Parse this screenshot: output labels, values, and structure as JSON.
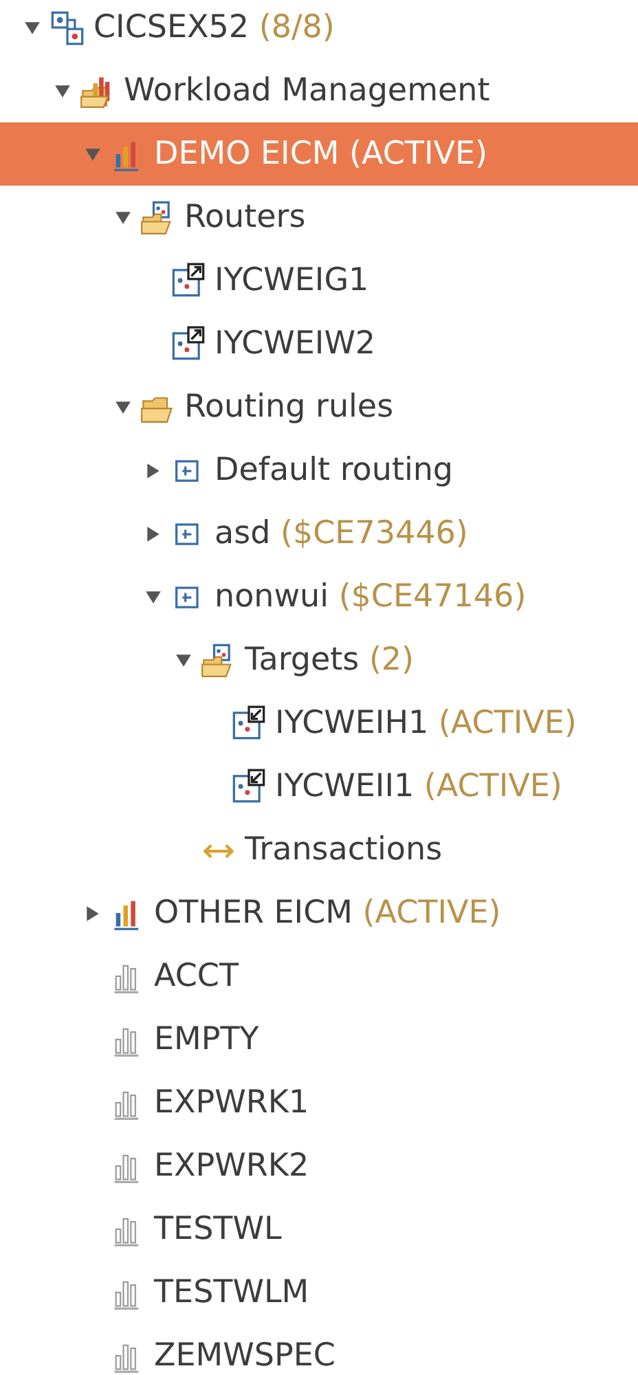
{
  "tree": [
    {
      "kind": "system",
      "label": "CICSEX52",
      "suffix": "(8/8)",
      "expanded": true,
      "selected": false,
      "children": [
        {
          "kind": "workload-folder",
          "label": "Workload Management",
          "expanded": true,
          "selected": false,
          "children": [
            {
              "kind": "workload-active",
              "label": "DEMO EICM (ACTIVE)",
              "expanded": true,
              "selected": true,
              "children": [
                {
                  "kind": "router-folder",
                  "label": "Routers",
                  "expanded": true,
                  "selected": false,
                  "children": [
                    {
                      "kind": "router",
                      "label": "IYCWEIG1",
                      "selected": false
                    },
                    {
                      "kind": "router",
                      "label": "IYCWEIW2",
                      "selected": false
                    }
                  ]
                },
                {
                  "kind": "folder",
                  "label": "Routing rules",
                  "expanded": true,
                  "selected": false,
                  "children": [
                    {
                      "kind": "rule",
                      "label": "Default routing",
                      "expanded": false,
                      "selected": false
                    },
                    {
                      "kind": "rule",
                      "label": "asd",
                      "suffix": "($CE73446)",
                      "expanded": false,
                      "selected": false
                    },
                    {
                      "kind": "rule",
                      "label": "nonwui",
                      "suffix": "($CE47146)",
                      "expanded": true,
                      "selected": false,
                      "children": [
                        {
                          "kind": "router-folder",
                          "label": "Targets",
                          "suffix": "(2)",
                          "expanded": true,
                          "selected": false,
                          "children": [
                            {
                              "kind": "target",
                              "label": "IYCWEIH1",
                              "suffix": "(ACTIVE)",
                              "selected": false
                            },
                            {
                              "kind": "target",
                              "label": "IYCWEII1",
                              "suffix": "(ACTIVE)",
                              "selected": false
                            }
                          ]
                        },
                        {
                          "kind": "transactions",
                          "label": "Transactions",
                          "selected": false
                        }
                      ]
                    }
                  ]
                }
              ]
            },
            {
              "kind": "workload-active",
              "label": "OTHER EICM",
              "suffix": "(ACTIVE)",
              "expanded": false,
              "selected": false
            },
            {
              "kind": "workload",
              "label": "ACCT",
              "selected": false
            },
            {
              "kind": "workload",
              "label": "EMPTY",
              "selected": false
            },
            {
              "kind": "workload",
              "label": "EXPWRK1",
              "selected": false
            },
            {
              "kind": "workload",
              "label": "EXPWRK2",
              "selected": false
            },
            {
              "kind": "workload",
              "label": "TESTWL",
              "selected": false
            },
            {
              "kind": "workload",
              "label": "TESTWLM",
              "selected": false
            },
            {
              "kind": "workload",
              "label": "ZEMWSPEC",
              "selected": false
            }
          ]
        }
      ]
    }
  ]
}
